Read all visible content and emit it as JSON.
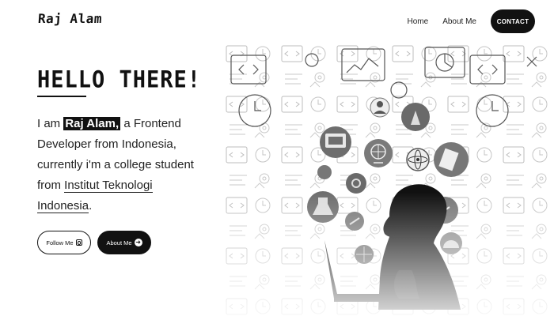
{
  "header": {
    "logo": "Raj Alam",
    "nav": {
      "home": "Home",
      "about": "About Me",
      "contact": "CONTACT"
    }
  },
  "hero": {
    "title": "HELLO THERE!",
    "intro_prefix": "I am ",
    "name": "Raj Alam,",
    "intro_middle": " a Frontend Developer from Indonesia, currently i'm a college student from ",
    "university": "Institut Teknologi Indonesia",
    "intro_suffix": "."
  },
  "buttons": {
    "follow": "Follow Me",
    "about": "About Me"
  },
  "icons": {
    "follow": "instagram-icon",
    "about": "arrow-right-circle-icon"
  },
  "colors": {
    "primary": "#111111",
    "background": "#ffffff"
  }
}
